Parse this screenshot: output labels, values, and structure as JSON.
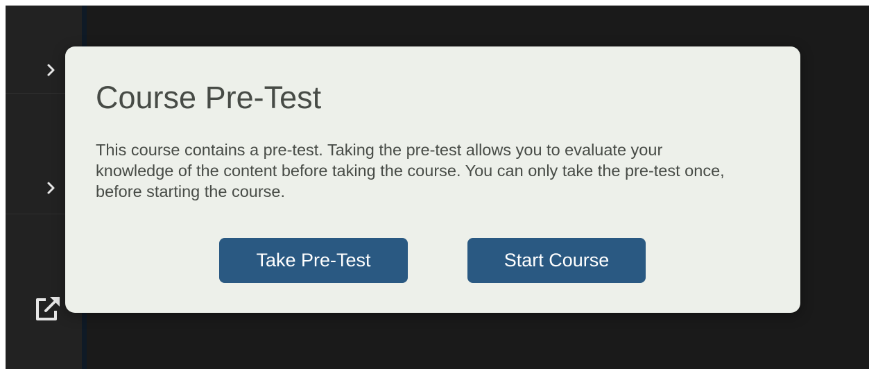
{
  "sidebar": {
    "items": [
      {
        "icon": "chevron-right-icon"
      },
      {
        "icon": "chevron-right-icon"
      }
    ],
    "external_icon": "external-link-icon"
  },
  "modal": {
    "title": "Course Pre-Test",
    "body": "This course contains a pre-test. Taking the pre-test allows you to evaluate your knowledge of the content before taking the course. You can only take the pre-test once, before starting the course.",
    "buttons": {
      "take_pretest": "Take Pre-Test",
      "start_course": "Start Course"
    }
  },
  "colors": {
    "backdrop": "#1a1a1a",
    "modal_background": "#edf0ea",
    "button_background": "#2a5982",
    "text": "#474b46"
  }
}
